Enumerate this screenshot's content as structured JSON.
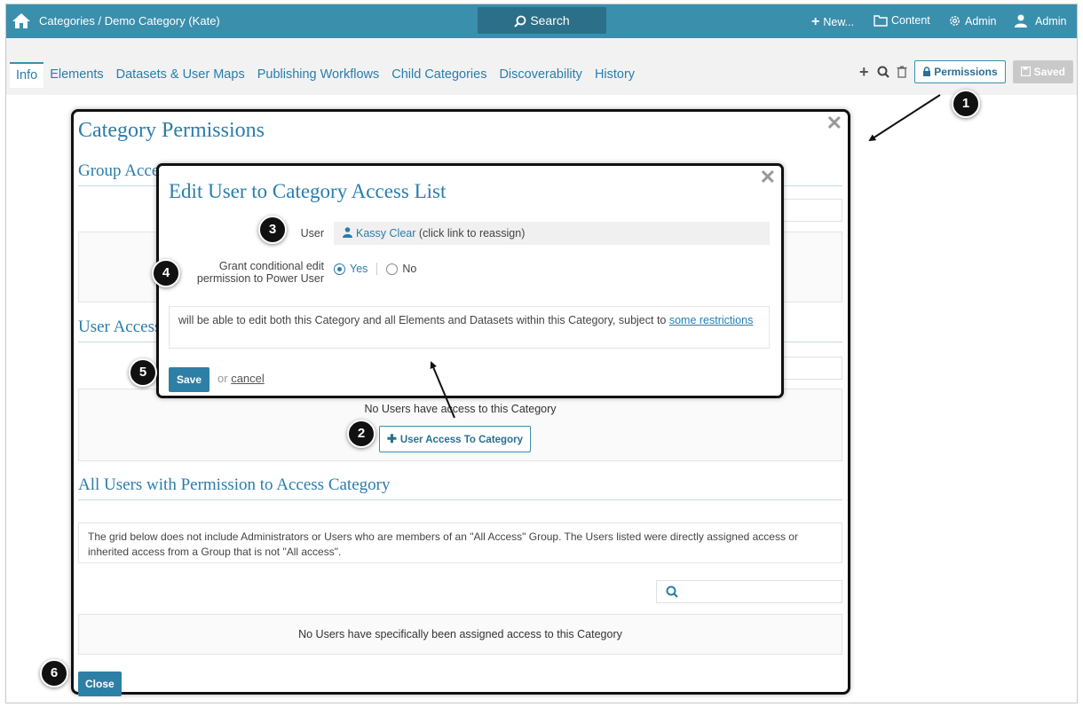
{
  "topbar": {
    "breadcrumb": "Categories / Demo Category (Kate)",
    "search": "Search",
    "new": "New...",
    "content": "Content",
    "admin_menu": "Admin",
    "user": "Admin",
    "color": "#3a8fad"
  },
  "tabs": [
    "Info",
    "Elements",
    "Datasets & User Maps",
    "Publishing Workflows",
    "Child Categories",
    "Discoverability",
    "History"
  ],
  "toolbar": {
    "permissions_label": "Permissions",
    "saved_label": "Saved"
  },
  "modal": {
    "title": "Category Permissions",
    "group_section": "Group Access",
    "user_section": "User Access",
    "no_users": "No Users have access to this Category",
    "add_user_button": "User Access To Category",
    "all_users_title": "All Users with Permission to Access Category",
    "note": "The grid below does not include Administrators or Users who are members of an \"All Access\" Group. The Users listed were directly assigned access or inherited access from a Group that is not \"All access\".",
    "no_assigned": "No Users have specifically been assigned access to this Category",
    "close_label": "Close"
  },
  "dialog": {
    "title": "Edit User to Category Access List",
    "user_label": "User",
    "user_name": "Kassy Clear",
    "user_hint": "(click link to reassign)",
    "grant_label_1": "Grant conditional edit",
    "grant_label_2": "permission to Power User",
    "yes": "Yes",
    "no": "No",
    "yes_selected": true,
    "desc_text": "will be able to edit both this Category and all Elements and Datasets within this Category, subject to",
    "desc_link": "some restrictions",
    "save_label": "Save",
    "or": "or",
    "cancel": "cancel"
  },
  "steps": [
    "1",
    "2",
    "3",
    "4",
    "5",
    "6"
  ]
}
